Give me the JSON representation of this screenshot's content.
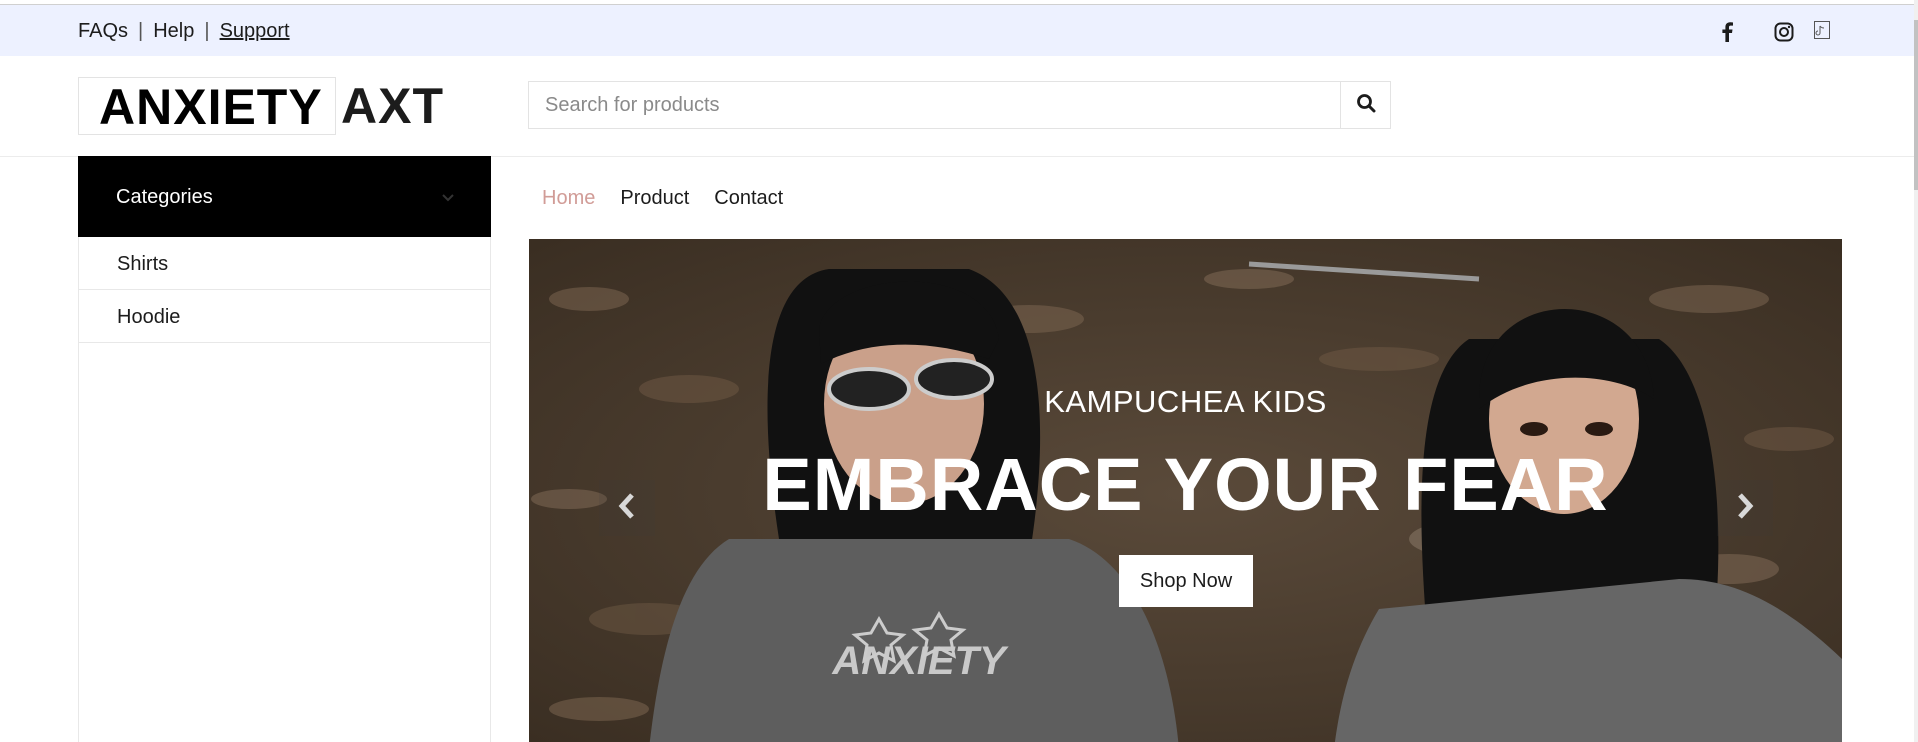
{
  "topbar": {
    "links": [
      "FAQs",
      "Help",
      "Support"
    ],
    "separator": "|",
    "social_icons": [
      "facebook-icon",
      "instagram-icon",
      "tiktok-icon"
    ]
  },
  "header": {
    "logo_part1": "ANXIETY",
    "logo_part2": "AXT",
    "search": {
      "placeholder": "Search for products",
      "value": ""
    },
    "search_icon": "search-icon"
  },
  "sidebar": {
    "title": "Categories",
    "toggle_icon": "chevron-down-icon",
    "items": [
      {
        "label": "Shirts"
      },
      {
        "label": "Hoodie"
      }
    ]
  },
  "nav": {
    "items": [
      {
        "label": "Home",
        "active": true
      },
      {
        "label": "Product",
        "active": false
      },
      {
        "label": "Contact",
        "active": false
      }
    ]
  },
  "hero": {
    "subtitle": "KAMPUCHEA KIDS",
    "title": "EMBRACE YOUR FEAR",
    "button_label": "Shop Now",
    "prev_icon": "chevron-left-icon",
    "next_icon": "chevron-right-icon",
    "shirt_print": "ANXIETY"
  },
  "colors": {
    "topbar_bg": "#edf1ff",
    "accent": "#d19c97",
    "category_bg": "#000000"
  }
}
